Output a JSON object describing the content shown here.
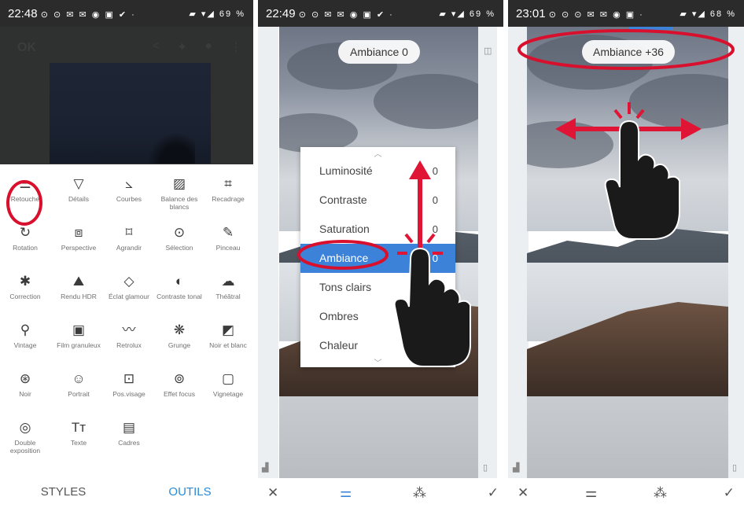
{
  "panel1": {
    "status": {
      "time": "22:48",
      "notif": "⊙ ⊙ ✉ ✉ ◉ ▣ ✔ ·",
      "net": "▰ ▾◢",
      "battery": "69 %"
    },
    "ok_label": "OK",
    "tools": [
      {
        "label": "Retouche",
        "icon": "sliders-icon",
        "glyph": "⚌"
      },
      {
        "label": "Détails",
        "icon": "triangle-down-icon",
        "glyph": "▽"
      },
      {
        "label": "Courbes",
        "icon": "curves-icon",
        "glyph": "⦣"
      },
      {
        "label": "Balance des blancs",
        "icon": "white-balance-icon",
        "glyph": "▨"
      },
      {
        "label": "Recadrage",
        "icon": "crop-icon",
        "glyph": "⌗"
      },
      {
        "label": "Rotation",
        "icon": "rotate-icon",
        "glyph": "↻"
      },
      {
        "label": "Perspective",
        "icon": "perspective-icon",
        "glyph": "⧈"
      },
      {
        "label": "Agrandir",
        "icon": "expand-icon",
        "glyph": "⌑"
      },
      {
        "label": "Sélection",
        "icon": "selection-icon",
        "glyph": "⊙"
      },
      {
        "label": "Pinceau",
        "icon": "brush-icon",
        "glyph": "✎"
      },
      {
        "label": "Correction",
        "icon": "healing-icon",
        "glyph": "✱"
      },
      {
        "label": "Rendu HDR",
        "icon": "hdr-icon",
        "glyph": "⛰"
      },
      {
        "label": "Éclat glamour",
        "icon": "glamour-icon",
        "glyph": "◇"
      },
      {
        "label": "Contraste tonal",
        "icon": "tonal-contrast-icon",
        "glyph": "◐"
      },
      {
        "label": "Théâtral",
        "icon": "drama-icon",
        "glyph": "☁"
      },
      {
        "label": "Vintage",
        "icon": "vintage-icon",
        "glyph": "⚲"
      },
      {
        "label": "Film granuleux",
        "icon": "grainy-film-icon",
        "glyph": "▣"
      },
      {
        "label": "Retrolux",
        "icon": "retrolux-icon",
        "glyph": "〰"
      },
      {
        "label": "Grunge",
        "icon": "grunge-icon",
        "glyph": "❋"
      },
      {
        "label": "Noir et blanc",
        "icon": "black-white-icon",
        "glyph": "◩"
      },
      {
        "label": "Noir",
        "icon": "noir-icon",
        "glyph": "⊛"
      },
      {
        "label": "Portrait",
        "icon": "portrait-icon",
        "glyph": "☺"
      },
      {
        "label": "Pos.visage",
        "icon": "face-pose-icon",
        "glyph": "⊡"
      },
      {
        "label": "Effet focus",
        "icon": "lens-blur-icon",
        "glyph": "⊚"
      },
      {
        "label": "Vignetage",
        "icon": "vignette-icon",
        "glyph": "▢"
      },
      {
        "label": "Double exposition",
        "icon": "double-exposure-icon",
        "glyph": "◎"
      },
      {
        "label": "Texte",
        "icon": "text-icon",
        "glyph": "Tт"
      },
      {
        "label": "Cadres",
        "icon": "frames-icon",
        "glyph": "▤"
      }
    ],
    "tab_styles": "STYLES",
    "tab_outils": "OUTILS"
  },
  "panel2": {
    "status": {
      "time": "22:49",
      "notif": "⊙ ⊙ ✉ ✉ ◉ ▣ ✔ ·",
      "net": "▰ ▾◢",
      "battery": "69 %"
    },
    "pill": "Ambiance 0",
    "menu": [
      {
        "label": "Luminosité",
        "value": "0"
      },
      {
        "label": "Contraste",
        "value": "0"
      },
      {
        "label": "Saturation",
        "value": "0"
      },
      {
        "label": "Ambiance",
        "value": "0"
      },
      {
        "label": "Tons clairs",
        "value": ""
      },
      {
        "label": "Ombres",
        "value": ""
      },
      {
        "label": "Chaleur",
        "value": ""
      }
    ]
  },
  "panel3": {
    "status": {
      "time": "23:01",
      "notif": "⊙ ⊙ ⊙ ✉ ✉ ◉ ▣ ·",
      "net": "▰ ▾◢",
      "battery": "68 %"
    },
    "pill": "Ambiance +36"
  },
  "colors": {
    "accent": "#3b82d8",
    "highlight": "#d8102d",
    "outils": "#2a8ad6"
  }
}
